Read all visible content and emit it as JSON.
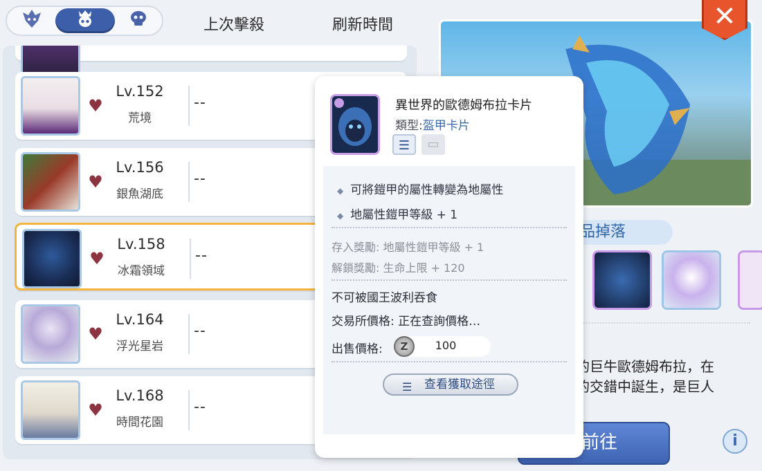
{
  "tabs": {
    "tab1_icon": "wolf-emblem-icon",
    "tab2_icon": "crown-skull-icon",
    "tab3_icon": "skull-icon"
  },
  "header": {
    "last_kill": "上次擊殺",
    "refresh_time": "刷新時間"
  },
  "bosses": [
    {
      "level": "Lv.152",
      "zone": "荒境",
      "time": "--"
    },
    {
      "level": "Lv.156",
      "zone": "銀魚湖底",
      "time": "--"
    },
    {
      "level": "Lv.158",
      "zone": "冰霜領域",
      "time": "--"
    },
    {
      "level": "Lv.164",
      "zone": "浮光星岩",
      "time": "--"
    },
    {
      "level": "Lv.168",
      "zone": "時間花園",
      "time": "--"
    }
  ],
  "item_popup": {
    "name": "異世界的歐德姆布拉卡片",
    "type_label": "類型:",
    "type_value": "盔甲卡片",
    "effects": [
      "可將鎧甲的屬性轉變為地屬性",
      "地屬性鎧甲等級 + 1"
    ],
    "deposit_reward": "存入獎勵: 地屬性鎧甲等級 + 1",
    "unlock_reward": "解鎖獎勵: 生命上限 + 120",
    "no_devour": "不可被國王波利吞食",
    "exchange_price": "交易所價格: 正在查詢價格…",
    "sell_label": "出售價格:",
    "sell_price": "100",
    "zeny_symbol": "Z",
    "view_source": "查看獲取途徑"
  },
  "right_panel": {
    "drops_title": "品掉落",
    "description_line1": "的巨牛歐德姆布拉，在",
    "description_line2": "的交錯中誕生，是巨人",
    "go_button": "前往",
    "info_symbol": "i",
    "close_symbol": "✕"
  },
  "colors": {
    "accent_blue": "#3d5ea8",
    "selected_border": "#f4b43c",
    "close_red": "#e8542c",
    "card_frame_purple": "#c89de8"
  }
}
